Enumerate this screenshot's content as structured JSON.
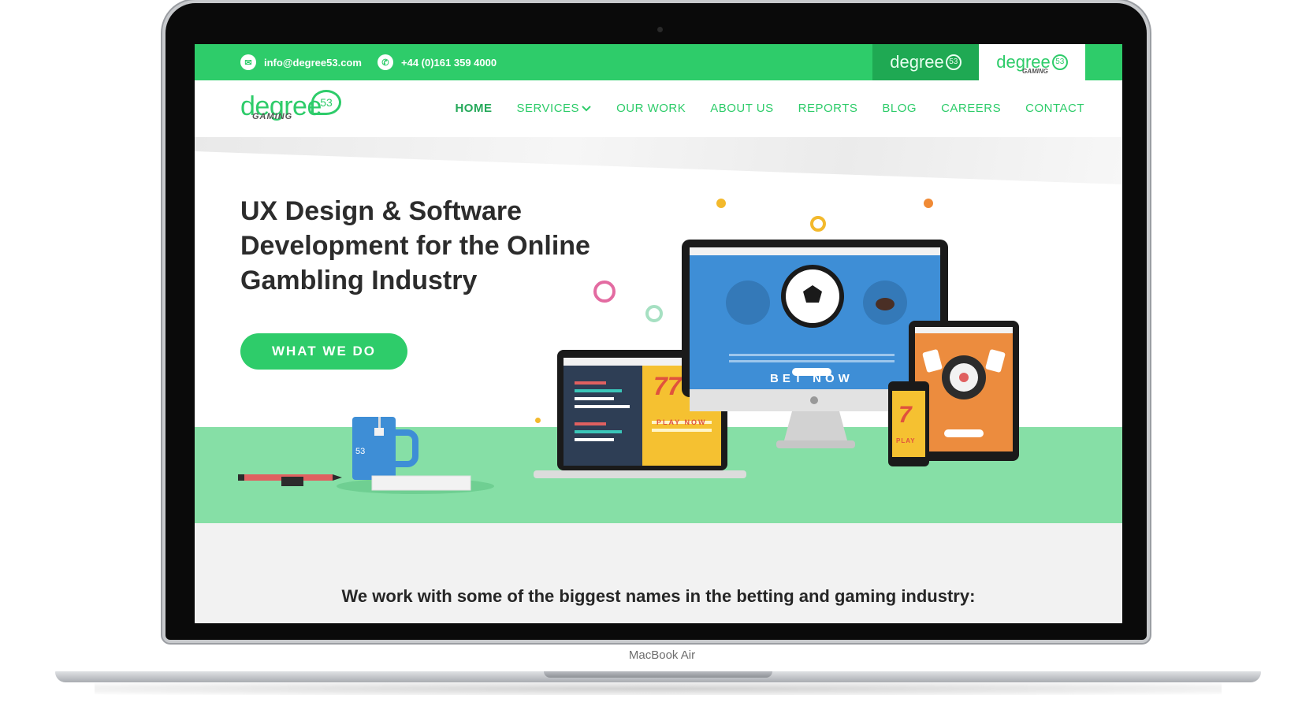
{
  "device": {
    "label": "MacBook Air"
  },
  "topbar": {
    "email": "info@degree53.com",
    "phone": "+44 (0)161 359 4000",
    "brand_tabs": [
      {
        "name": "degree",
        "badge": "53",
        "sub": ""
      },
      {
        "name": "degree",
        "badge": "53",
        "sub": "GAMING"
      }
    ]
  },
  "nav": {
    "logo": {
      "name": "degree",
      "badge": "53",
      "sub": "GAMING"
    },
    "items": [
      {
        "label": "HOME",
        "active": true
      },
      {
        "label": "SERVICES",
        "dropdown": true
      },
      {
        "label": "OUR WORK"
      },
      {
        "label": "ABOUT US"
      },
      {
        "label": "REPORTS"
      },
      {
        "label": "BLOG"
      },
      {
        "label": "CAREERS"
      },
      {
        "label": "CONTACT"
      }
    ]
  },
  "hero": {
    "title": "UX Design & Software Development for the Online Gambling Industry",
    "cta_label": "WHAT WE DO",
    "illustration": {
      "mug_badge": "53",
      "laptop_slot": "777",
      "laptop_play": "PLAY NOW",
      "monitor_bet": "BET NOW",
      "phone_slot": "7",
      "phone_play": "PLAY"
    }
  },
  "partners": {
    "heading": "We work with some of the biggest names in the betting and gaming industry:"
  },
  "colors": {
    "brand_green": "#2ecc6a",
    "dark_green": "#1fa953",
    "ground_green": "#86dfa6",
    "title_text": "#2c2c2c"
  }
}
